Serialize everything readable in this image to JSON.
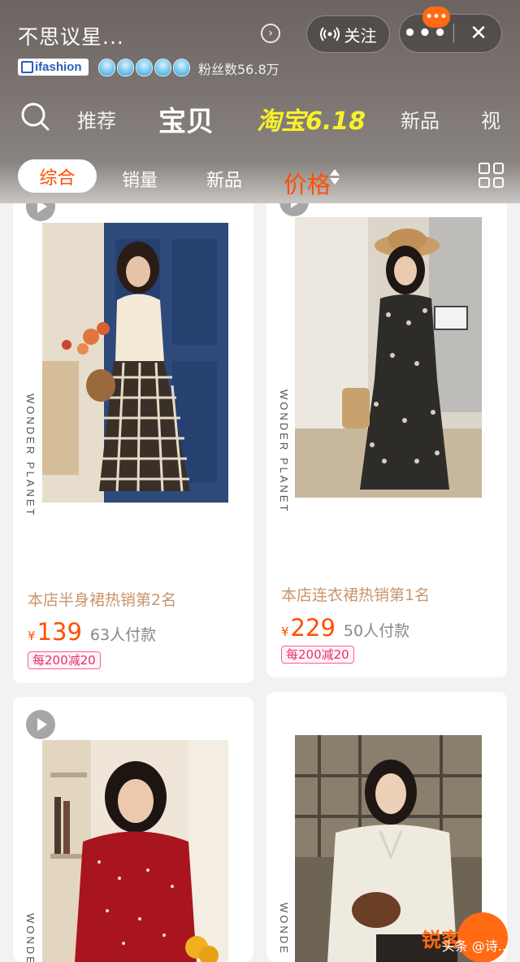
{
  "header": {
    "store_name": "不思议星...",
    "follow_label": "关注",
    "more_label": "•••",
    "close_label": "✕",
    "notify_badge": "•••",
    "brand_badge": "ifashion",
    "fans_text": "粉丝数56.8万",
    "crown_count": 5
  },
  "nav": {
    "tabs": [
      "推荐",
      "宝贝",
      "淘宝6.18",
      "新品",
      "视"
    ],
    "active": "宝贝"
  },
  "sort": {
    "items": [
      "综合",
      "销量",
      "新品",
      "价格"
    ],
    "active": "综合"
  },
  "products": [
    {
      "title": "本店半身裙热销第2名",
      "currency": "¥",
      "price": "139",
      "sold": "63人付款",
      "coupon": "每200减20",
      "watermark": "WONDER PLANET",
      "photo_colors": [
        "#2d4a7a",
        "#e9dfd0",
        "#3a3028"
      ]
    },
    {
      "title": "本店连衣裙热销第1名",
      "currency": "¥",
      "price": "229",
      "sold": "50人付款",
      "coupon": "每200减20",
      "watermark": "WONDER PLANET",
      "photo_colors": [
        "#d9d4c8",
        "#3b3a35",
        "#b89a76"
      ]
    },
    {
      "watermark": "WONDE",
      "photo_colors": [
        "#efe6d9",
        "#a8151f",
        "#3a2a22"
      ]
    },
    {
      "watermark": "WONDE",
      "photo_colors": [
        "#6e6455",
        "#efeae0",
        "#3b2c22"
      ]
    }
  ],
  "footer": {
    "watermark_text": "头条 @诗...",
    "site_label": "锐客网"
  }
}
